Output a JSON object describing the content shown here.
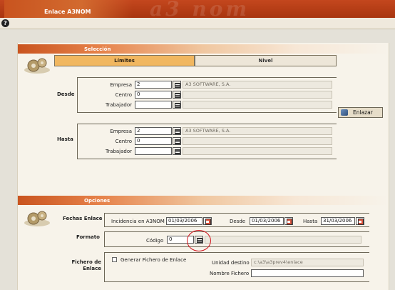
{
  "window": {
    "title": "Enlace A3NOM"
  },
  "toolbar": {
    "help_symbol": "?"
  },
  "seleccion": {
    "section_title": "Selección",
    "tabs": [
      {
        "label": "Límites",
        "active": true
      },
      {
        "label": "Nivel",
        "active": false
      }
    ],
    "desde": {
      "label": "Desde",
      "empresa_label": "Empresa",
      "empresa_value": "2",
      "empresa_name": "A3 SOFTWARE, S.A.",
      "centro_label": "Centro",
      "centro_value": "0",
      "centro_name": "",
      "trabajador_label": "Trabajador",
      "trabajador_value": "",
      "trabajador_name": ""
    },
    "hasta": {
      "label": "Hasta",
      "empresa_label": "Empresa",
      "empresa_value": "2",
      "empresa_name": "A3 SOFTWARE, S.A.",
      "centro_label": "Centro",
      "centro_value": "0",
      "centro_name": "",
      "trabajador_label": "Trabajador",
      "trabajador_value": "",
      "trabajador_name": ""
    },
    "enlazar_label": "Enlazar"
  },
  "opciones": {
    "section_title": "Opciones",
    "fechas": {
      "label": "Fechas Enlace",
      "incidencia_label": "Incidencia en A3NOM",
      "incidencia_value": "01/03/2006",
      "desde_label": "Desde",
      "desde_value": "01/03/2006",
      "hasta_label": "Hasta",
      "hasta_value": "31/03/2006"
    },
    "formato": {
      "label": "Formato",
      "codigo_label": "Código",
      "codigo_value": "0",
      "codigo_name": ""
    },
    "fichero": {
      "label": "Fichero de Enlace",
      "checkbox_label": "Generar Fichero de Enlace",
      "checked": false,
      "unidad_label": "Unidad destino",
      "unidad_value": "c:\\a3\\a3prev4\\enlace",
      "nombre_label": "Nombre Fichero",
      "nombre_value": ""
    }
  },
  "colors": {
    "accent": "#c9541f",
    "tab_active": "#f1b760",
    "highlight_ring": "#d0121b"
  }
}
